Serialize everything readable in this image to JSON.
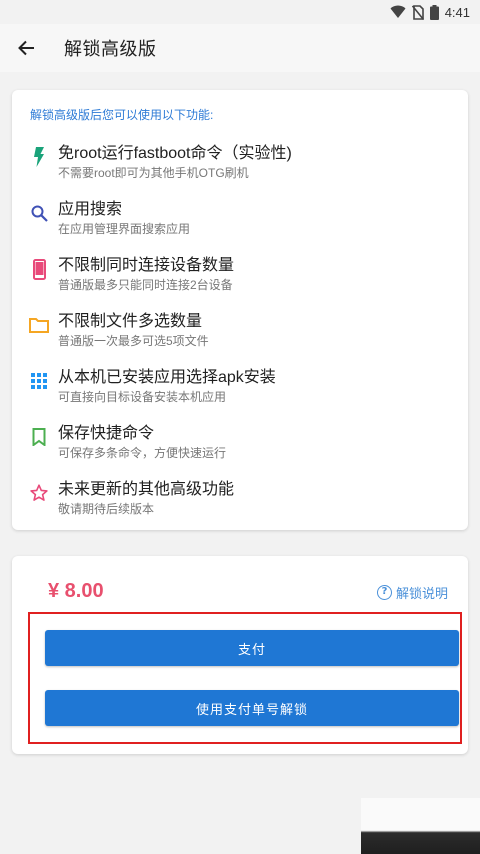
{
  "status_bar": {
    "time": "4:41"
  },
  "app_bar": {
    "title": "解锁高级版"
  },
  "features": {
    "header": "解锁高级版后您可以使用以下功能:",
    "items": [
      {
        "title": "免root运行fastboot命令（实验性)",
        "subtitle": "不需要root即可为其他手机OTG刷机",
        "icon": "bolt-icon",
        "color": "#1aa37a"
      },
      {
        "title": "应用搜索",
        "subtitle": "在应用管理界面搜索应用",
        "icon": "search-icon",
        "color": "#3f51b5"
      },
      {
        "title": "不限制同时连接设备数量",
        "subtitle": "普通版最多只能同时连接2台设备",
        "icon": "phone-icon",
        "color": "#e84a7a"
      },
      {
        "title": "不限制文件多选数量",
        "subtitle": "普通版一次最多可选5项文件",
        "icon": "folder-icon",
        "color": "#f5a623"
      },
      {
        "title": "从本机已安装应用选择apk安装",
        "subtitle": "可直接向目标设备安装本机应用",
        "icon": "grid-icon",
        "color": "#2196f3"
      },
      {
        "title": "保存快捷命令",
        "subtitle": "可保存多条命令，方便快速运行",
        "icon": "bookmark-icon",
        "color": "#4caf50"
      },
      {
        "title": "未来更新的其他高级功能",
        "subtitle": "敬请期待后续版本",
        "icon": "star-icon",
        "color": "#e84a7a"
      }
    ]
  },
  "payment": {
    "price": "¥ 8.00",
    "help_label": "解锁说明",
    "pay_button": "支付",
    "order_button": "使用支付单号解锁"
  }
}
